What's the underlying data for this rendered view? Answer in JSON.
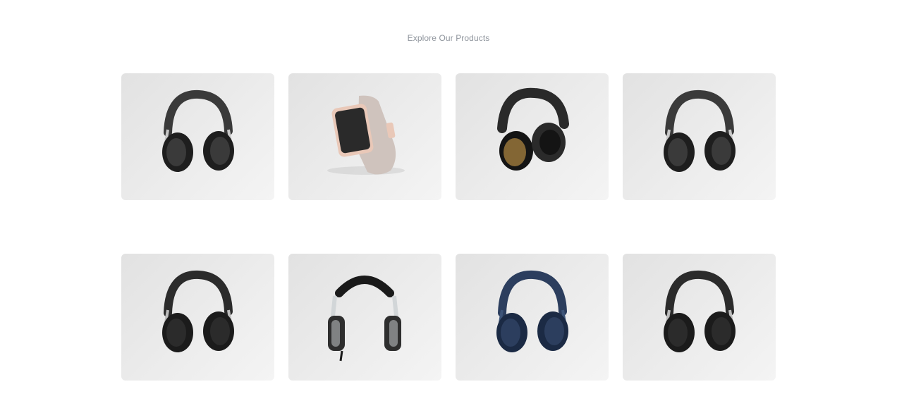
{
  "section": {
    "title": "Explore Our Products"
  },
  "products": [
    {
      "kind": "headphones-black-over-ear",
      "icon": "headphones-icon",
      "colors": {
        "primary": "#3a3a3a",
        "accent": "#1e1e1e",
        "trim": "#c9c9c9"
      }
    },
    {
      "kind": "smartwatch-rose-gold",
      "icon": "smartwatch-icon",
      "colors": {
        "primary": "#e9c8b8",
        "accent": "#2a2a2a",
        "trim": "#cfc3bd"
      }
    },
    {
      "kind": "headphones-black-gold",
      "icon": "headphones-icon",
      "colors": {
        "primary": "#2a2a2a",
        "accent": "#141414",
        "trim": "#a8813f"
      }
    },
    {
      "kind": "headphones-black-over-ear",
      "icon": "headphones-icon",
      "colors": {
        "primary": "#3a3a3a",
        "accent": "#1e1e1e",
        "trim": "#c9c9c9"
      }
    },
    {
      "kind": "headphones-black-on-ear",
      "icon": "headphones-icon",
      "colors": {
        "primary": "#2b2b2b",
        "accent": "#1b1b1b",
        "trim": "#bdbdbd"
      }
    },
    {
      "kind": "headphones-dj-silver",
      "icon": "headphones-icon",
      "colors": {
        "primary": "#2e2e2e",
        "accent": "#1a1a1a",
        "trim": "#d2d6d8"
      }
    },
    {
      "kind": "headphones-navy-on-ear",
      "icon": "headphones-icon",
      "colors": {
        "primary": "#2c3e5e",
        "accent": "#1b2a44",
        "trim": "#3d5478"
      }
    },
    {
      "kind": "headphones-black-on-ear",
      "icon": "headphones-icon",
      "colors": {
        "primary": "#2b2b2b",
        "accent": "#1b1b1b",
        "trim": "#bdbdbd"
      }
    }
  ]
}
